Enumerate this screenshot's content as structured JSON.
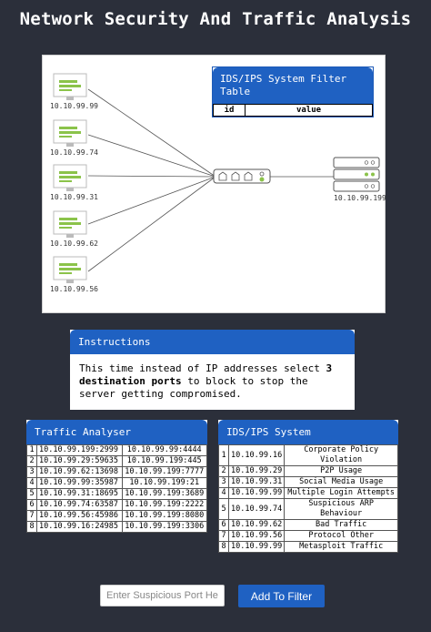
{
  "title": "Network Security And Traffic Analysis",
  "diagram": {
    "clients": [
      "10.10.99.99",
      "10.10.99.74",
      "10.10.99.31",
      "10.10.99.62",
      "10.10.99.56"
    ],
    "server": "10.10.99.199",
    "filter_table": {
      "title": "IDS/IPS System Filter Table",
      "columns": [
        "id",
        "value"
      ]
    }
  },
  "instructions": {
    "title": "Instructions",
    "text_before": "This time instead of IP addresses select ",
    "text_bold": "3 destination ports",
    "text_after": " to block to stop the server getting compromised."
  },
  "traffic": {
    "title": "Traffic Analyser",
    "rows": [
      {
        "id": "1",
        "src": "10.10.99.199:2999",
        "dst": "10.10.99.99:4444"
      },
      {
        "id": "2",
        "src": "10.10.99.29:59635",
        "dst": "10.10.99.199:445"
      },
      {
        "id": "3",
        "src": "10.10.99.62:13698",
        "dst": "10.10.99.199:7777"
      },
      {
        "id": "4",
        "src": "10.10.99.99:35987",
        "dst": "10.10.99.199:21"
      },
      {
        "id": "5",
        "src": "10.10.99.31:18695",
        "dst": "10.10.99.199:3689"
      },
      {
        "id": "6",
        "src": "10.10.99.74:63587",
        "dst": "10.10.99.199:2222"
      },
      {
        "id": "7",
        "src": "10.10.99.56:45986",
        "dst": "10.10.99.199:8080"
      },
      {
        "id": "8",
        "src": "10.10.99.16:24985",
        "dst": "10.10.99.199:3306"
      }
    ]
  },
  "ids": {
    "title": "IDS/IPS System",
    "rows": [
      {
        "id": "1",
        "ip": "10.10.99.16",
        "desc": "Corporate Policy Violation"
      },
      {
        "id": "2",
        "ip": "10.10.99.29",
        "desc": "P2P Usage"
      },
      {
        "id": "3",
        "ip": "10.10.99.31",
        "desc": "Social Media Usage"
      },
      {
        "id": "4",
        "ip": "10.10.99.99",
        "desc": "Multiple Login Attempts"
      },
      {
        "id": "5",
        "ip": "10.10.99.74",
        "desc": "Suspicious ARP Behaviour"
      },
      {
        "id": "6",
        "ip": "10.10.99.62",
        "desc": "Bad Traffic"
      },
      {
        "id": "7",
        "ip": "10.10.99.56",
        "desc": "Protocol Other"
      },
      {
        "id": "8",
        "ip": "10.10.99.99",
        "desc": "Metasploit Traffic"
      }
    ]
  },
  "controls": {
    "port_placeholder": "Enter Suspicious Port Here",
    "add_label": "Add To Filter"
  },
  "colors": {
    "accent": "#1f61c2",
    "background": "#2b2f3a",
    "monitor_green": "#8bc34a"
  }
}
